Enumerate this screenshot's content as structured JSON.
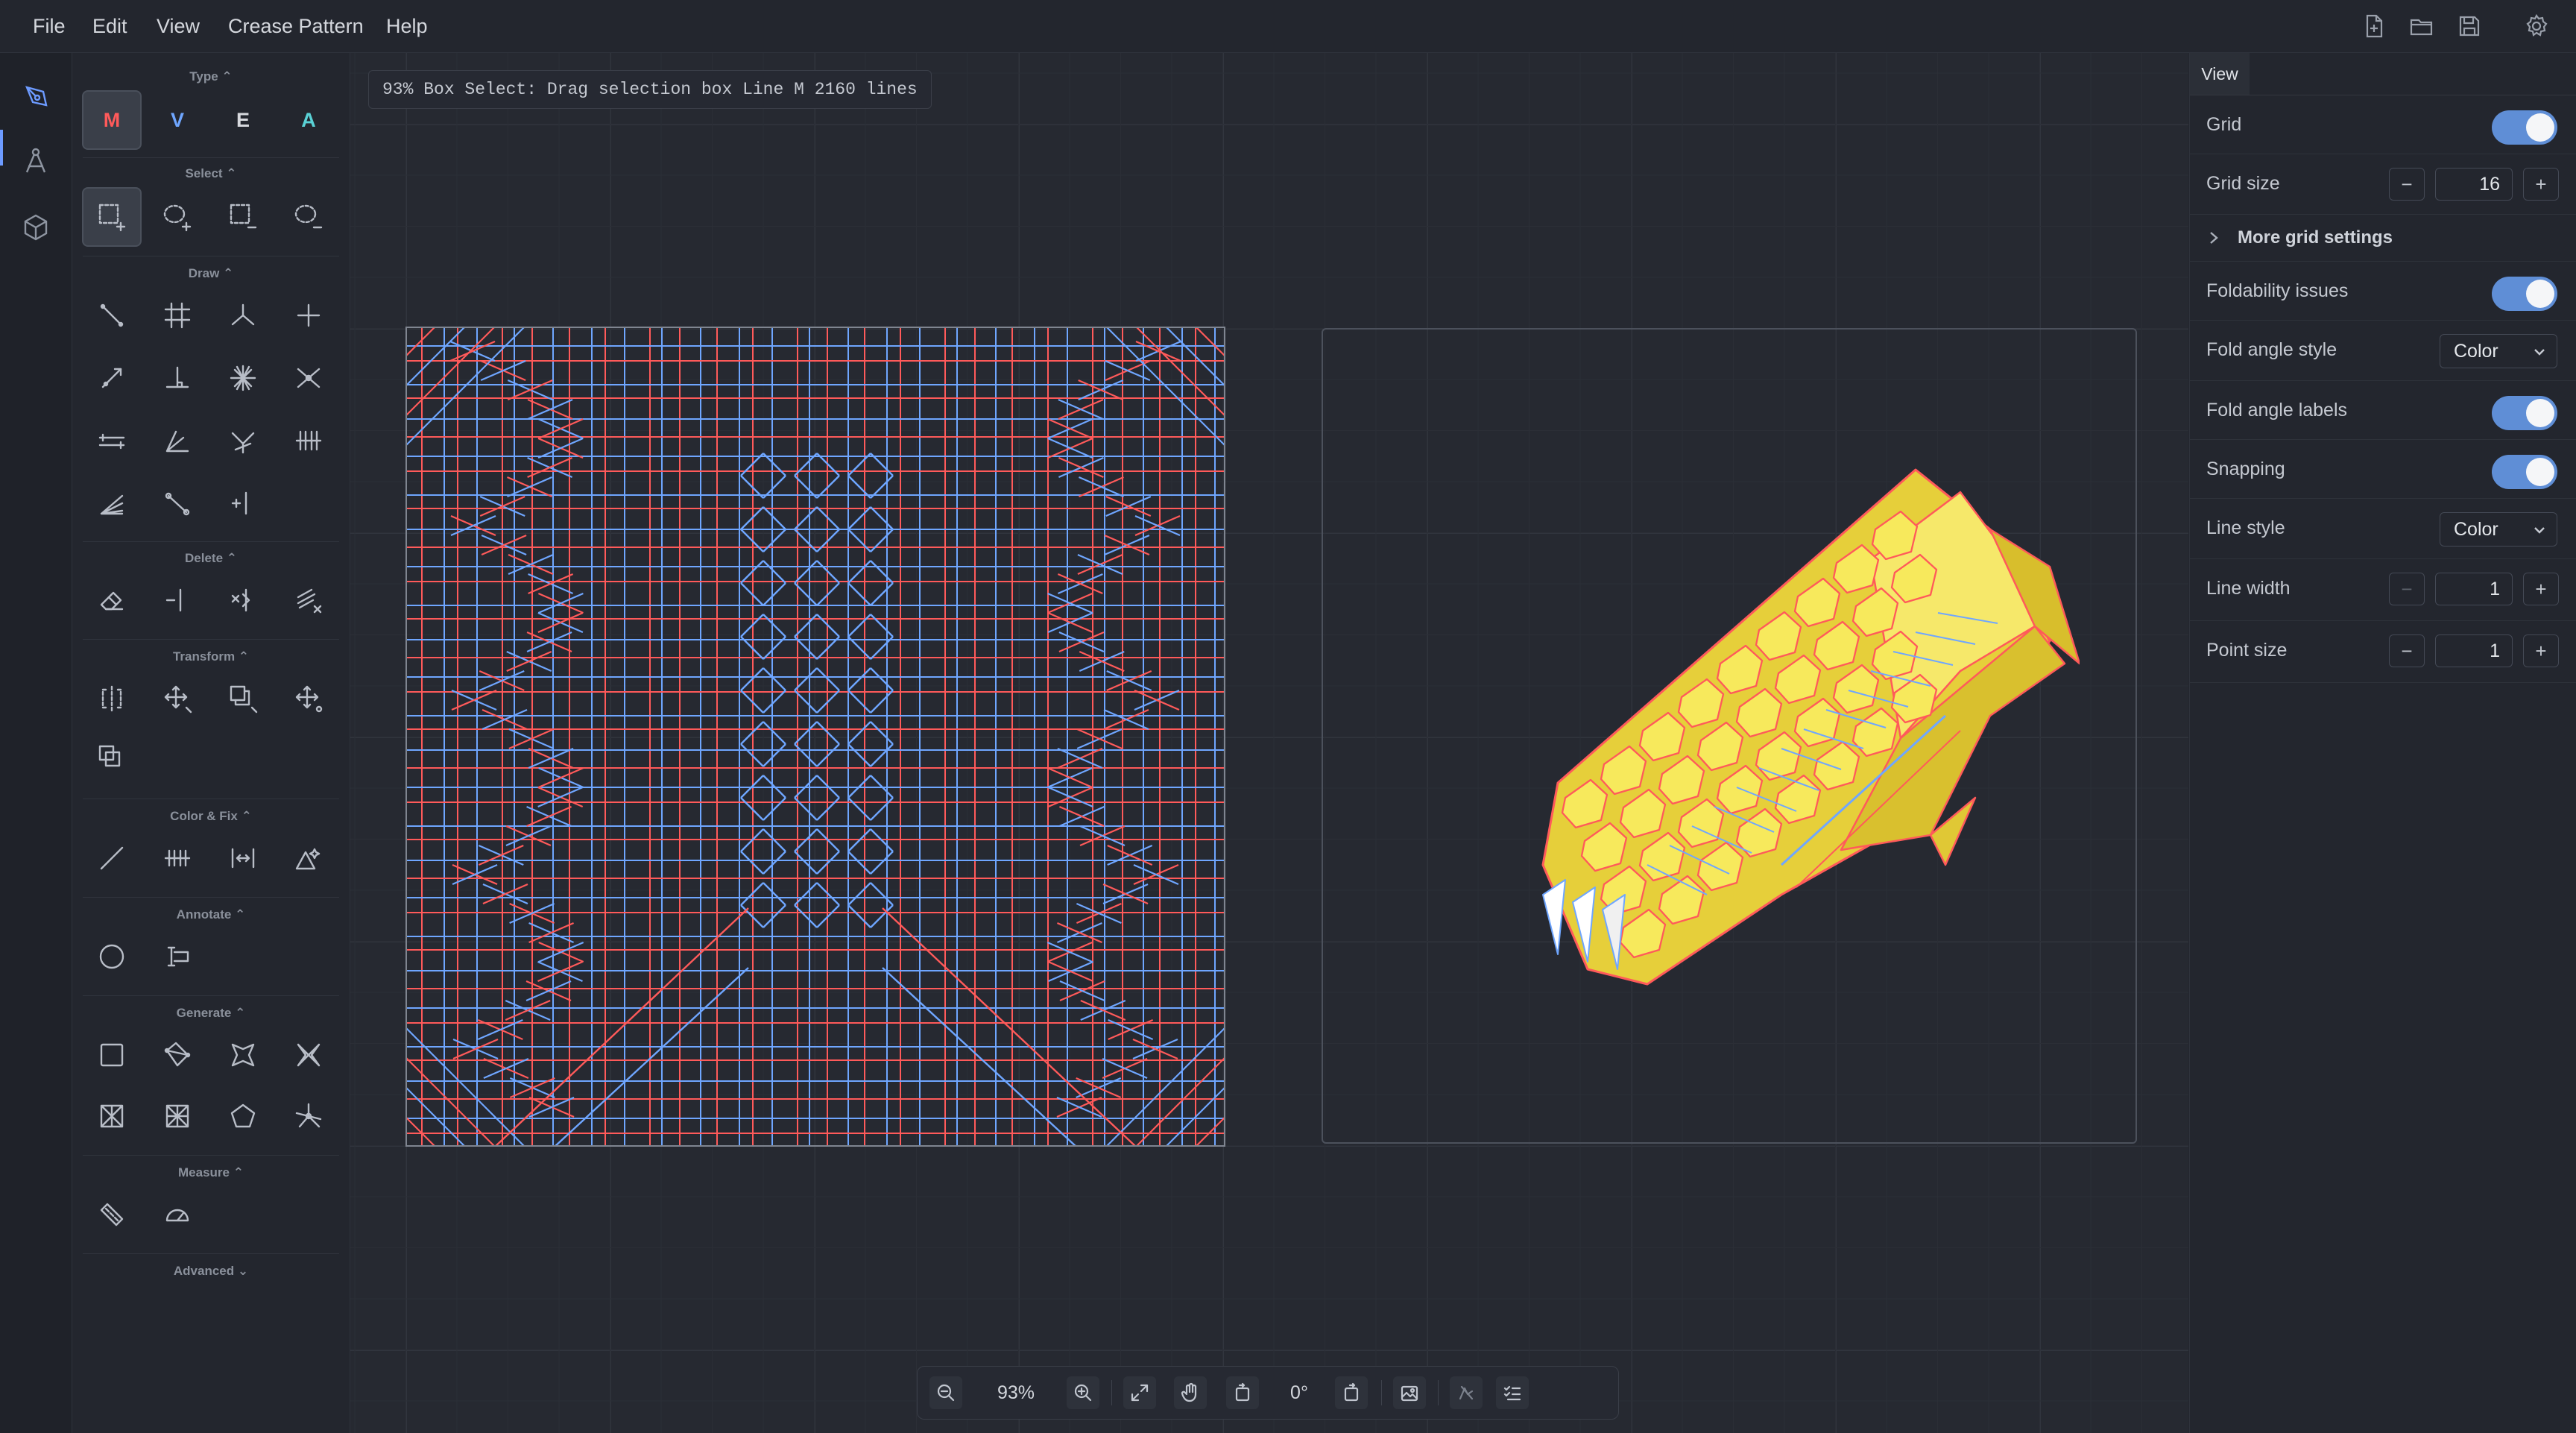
{
  "menu": [
    "File",
    "Edit",
    "View",
    "Crease Pattern",
    "Help"
  ],
  "status_text": "93% Box Select: Drag selection box Line M 2160 lines",
  "sections": {
    "type": "Type ⌃",
    "select": "Select ⌃",
    "draw": "Draw ⌃",
    "delete": "Delete ⌃",
    "transform": "Transform ⌃",
    "color_fix": "Color & Fix ⌃",
    "annotate": "Annotate ⌃",
    "generate": "Generate ⌃",
    "measure": "Measure ⌃",
    "advanced": "Advanced ⌄"
  },
  "type_buttons": [
    {
      "label": "M",
      "color": "#ff5a5a"
    },
    {
      "label": "V",
      "color": "#6fa6ff"
    },
    {
      "label": "E",
      "color": "#d7d9de"
    },
    {
      "label": "A",
      "color": "#5ad2d6"
    }
  ],
  "bottom_bar": {
    "zoom": "93%",
    "rotation": "0°"
  },
  "view_panel": {
    "tab": "View",
    "grid": "Grid",
    "grid_size_label": "Grid size",
    "grid_size": "16",
    "more_grid": "More grid settings",
    "foldability": "Foldability issues",
    "fold_angle_style": "Fold angle style",
    "fold_angle_style_value": "Color",
    "fold_angle_labels": "Fold angle labels",
    "snapping": "Snapping",
    "line_style": "Line style",
    "line_style_value": "Color",
    "line_width_label": "Line width",
    "line_width": "1",
    "point_size_label": "Point size",
    "point_size": "1",
    "minus": "−",
    "plus": "+"
  },
  "colors": {
    "mountain": "#ff5a5a",
    "valley": "#6fa6ff",
    "accent": "#6d9bff",
    "toggle": "#5f8ed6",
    "model": "#f2e14a"
  }
}
